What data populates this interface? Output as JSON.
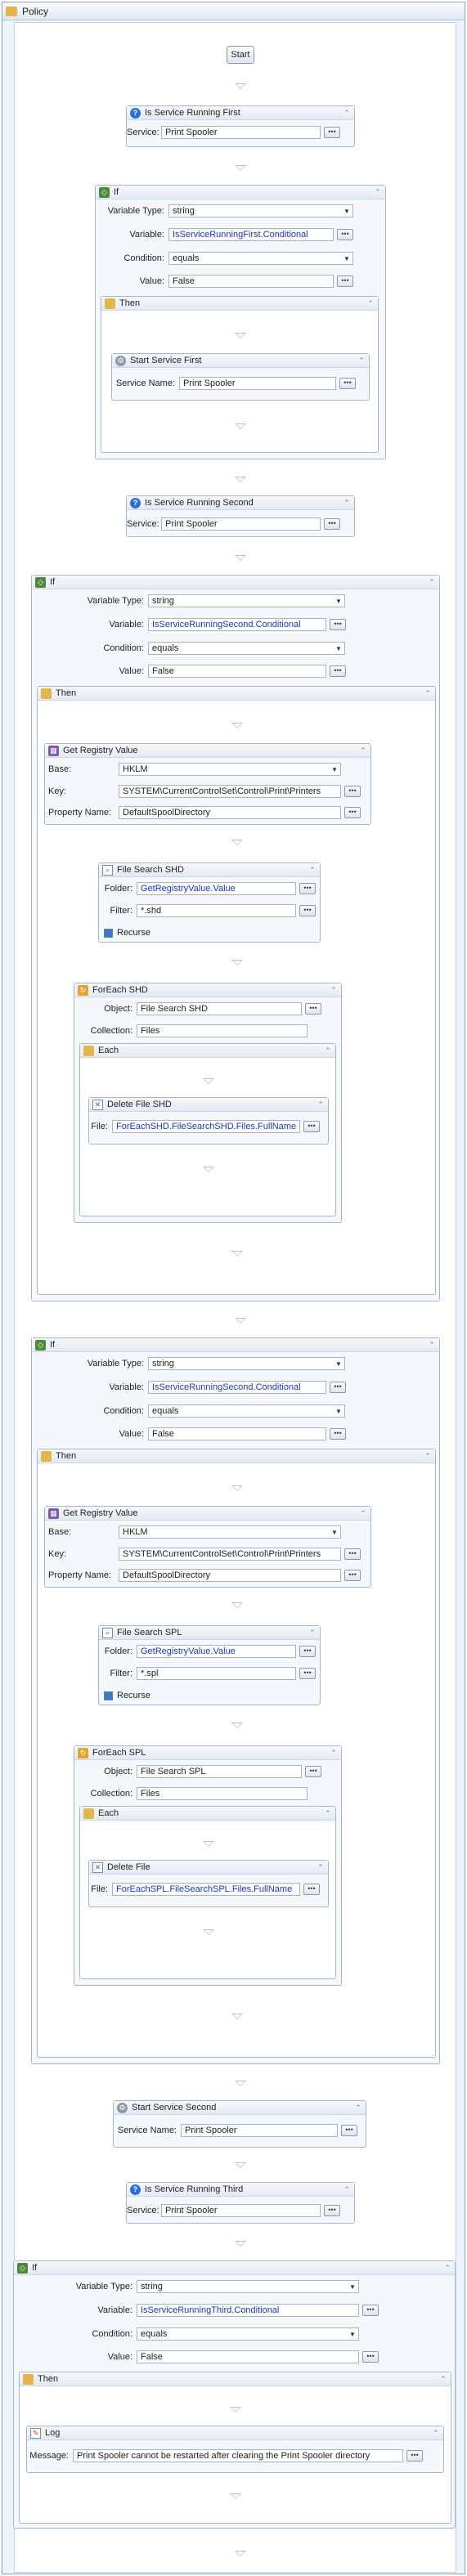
{
  "window": {
    "title": "Policy"
  },
  "start": {
    "label": "Start"
  },
  "running_first": {
    "title": "Is Service Running First",
    "service_label": "Service:",
    "service_value": "Print Spooler"
  },
  "if1": {
    "title": "If",
    "variable_type_label": "Variable Type:",
    "variable_type": "string",
    "variable_label": "Variable:",
    "variable": "IsServiceRunningFirst.Conditional",
    "condition_label": "Condition:",
    "condition": "equals",
    "value_label": "Value:",
    "value": "False",
    "then_title": "Then",
    "start_service": {
      "title": "Start Service First",
      "name_label": "Service Name:",
      "name_value": "Print Spooler"
    }
  },
  "running_second": {
    "title": "Is Service Running Second",
    "service_label": "Service:",
    "service_value": "Print Spooler"
  },
  "if2": {
    "title": "If",
    "variable_type_label": "Variable Type:",
    "variable_type": "string",
    "variable_label": "Variable:",
    "variable": "IsServiceRunningSecond.Conditional",
    "condition_label": "Condition:",
    "condition": "equals",
    "value_label": "Value:",
    "value": "False",
    "then_title": "Then",
    "registry": {
      "title": "Get Registry Value",
      "base_label": "Base:",
      "base": "HKLM",
      "key_label": "Key:",
      "key": "SYSTEM\\CurrentControlSet\\Control\\Print\\Printers",
      "prop_label": "Property Name:",
      "prop": "DefaultSpoolDirectory"
    },
    "search": {
      "title": "File Search SHD",
      "folder_label": "Folder:",
      "folder": "GetRegistryValue.Value",
      "filter_label": "Filter:",
      "filter": "*.shd",
      "recurse": "Recurse"
    },
    "foreach": {
      "title": "ForEach SHD",
      "object_label": "Object:",
      "object": "File Search SHD",
      "collection_label": "Collection:",
      "collection": "Files",
      "each_title": "Each",
      "delete": {
        "title": "Delete File SHD",
        "file_label": "File:",
        "file": "ForEachSHD.FileSearchSHD.Files.FullName"
      }
    }
  },
  "if3": {
    "title": "If",
    "variable_type_label": "Variable Type:",
    "variable_type": "string",
    "variable_label": "Variable:",
    "variable": "IsServiceRunningSecond.Conditional",
    "condition_label": "Condition:",
    "condition": "equals",
    "value_label": "Value:",
    "value": "False",
    "then_title": "Then",
    "registry": {
      "title": "Get Registry Value",
      "base_label": "Base:",
      "base": "HKLM",
      "key_label": "Key:",
      "key": "SYSTEM\\CurrentControlSet\\Control\\Print\\Printers",
      "prop_label": "Property Name:",
      "prop": "DefaultSpoolDirectory"
    },
    "search": {
      "title": "File Search SPL",
      "folder_label": "Folder:",
      "folder": "GetRegistryValue.Value",
      "filter_label": "Filter:",
      "filter": "*.spl",
      "recurse": "Recurse"
    },
    "foreach": {
      "title": "ForEach SPL",
      "object_label": "Object:",
      "object": "File Search SPL",
      "collection_label": "Collection:",
      "collection": "Files",
      "each_title": "Each",
      "delete": {
        "title": "Delete File",
        "file_label": "File:",
        "file": "ForEachSPL.FileSearchSPL.Files.FullName"
      }
    }
  },
  "start_second": {
    "title": "Start Service Second",
    "name_label": "Service Name:",
    "name_value": "Print Spooler"
  },
  "running_third": {
    "title": "Is Service Running Third",
    "service_label": "Service:",
    "service_value": "Print Spooler"
  },
  "if4": {
    "title": "If",
    "variable_type_label": "Variable Type:",
    "variable_type": "string",
    "variable_label": "Variable:",
    "variable": "IsServiceRunningThird.Conditional",
    "condition_label": "Condition:",
    "condition": "equals",
    "value_label": "Value:",
    "value": "False",
    "then_title": "Then",
    "log": {
      "title": "Log",
      "message_label": "Message:",
      "message": "Print Spooler cannot be restarted after clearing the Print Spooler directory"
    }
  },
  "icons": {
    "collapse": "double-chevron-up-icon",
    "ellipsis": "ellipsis-button-icon"
  },
  "colors": {
    "accent": "#2d6fd1",
    "border": "#a9b6c9",
    "variable_text": "#1a3aa8"
  }
}
